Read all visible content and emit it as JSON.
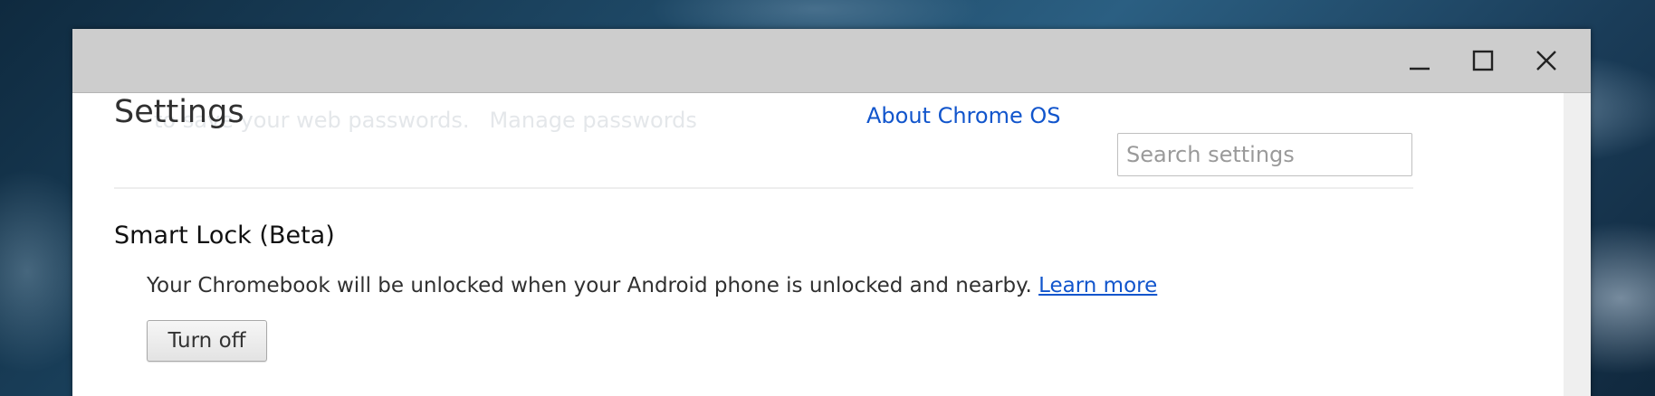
{
  "window": {
    "controls": {
      "minimize_icon": "minimize-icon",
      "maximize_icon": "maximize-icon",
      "close_icon": "close-icon"
    }
  },
  "header": {
    "ghost_text": "to save your web passwords.",
    "ghost_link": "Manage passwords",
    "title": "Settings",
    "about_link": "About Chrome OS",
    "search": {
      "placeholder": "Search settings",
      "value": ""
    }
  },
  "smart_lock": {
    "title": "Smart Lock (Beta)",
    "description": "Your Chromebook will be unlocked when your Android phone is unlocked and nearby.",
    "learn_more": "Learn more",
    "button_label": "Turn off"
  },
  "colors": {
    "titlebar": "#cdcdcd",
    "link": "#1155cc",
    "text": "#303030"
  }
}
